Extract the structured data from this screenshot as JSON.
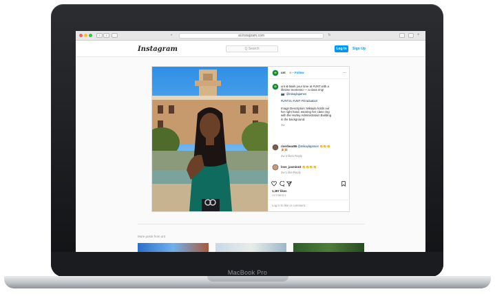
{
  "browser": {
    "url": "ai.instagram.com",
    "traffic_colors": [
      "#ff5f57",
      "#febc2e",
      "#28c840"
    ]
  },
  "device": {
    "brand_text": "MacBook Pro"
  },
  "instagram": {
    "logo_text": "Instagram",
    "search_placeholder": "Q Search",
    "login_label": "Log In",
    "signup_label": "Sign Up",
    "accent_color": "#0095f6"
  },
  "post": {
    "username": "unt",
    "follow_label": "Follow",
    "more_glyph": "···",
    "caption_lines": [
      "unt ⊛ Mark your time at #UNT with a",
      "lifetime memento — a class ring!",
      "📷: @mkaylajames"
    ],
    "hashtags": "#UNT21 #UNT #Graduation",
    "description_lines": [
      "Image Description: Mikayla holds out",
      "her right hand, wearing her class ring",
      "with the Hurley Administration Building",
      "in the background."
    ],
    "caption_age": "3w",
    "comments": [
      {
        "user": "riverbear86",
        "text": "@mikaylajames 👏👏👏",
        "text2": "🎉🎉",
        "meta": "2w 3 likes Reply"
      },
      {
        "user": "love_jasmine3",
        "text": "👏👏👏👏",
        "text2": "",
        "meta": "2w 1 like Reply"
      }
    ],
    "likes": "1,387 likes",
    "post_date": "OCTOBER 9",
    "login_prompt": "Log in to like or comment."
  },
  "more_posts": {
    "label": "More posts from unt"
  }
}
